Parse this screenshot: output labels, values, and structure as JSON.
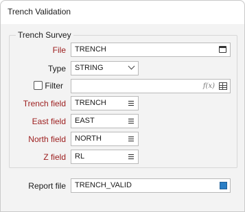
{
  "window": {
    "title": "Trench Validation"
  },
  "group": {
    "title": "Trench Survey"
  },
  "form": {
    "file": {
      "label": "File",
      "value": "TRENCH"
    },
    "type": {
      "label": "Type",
      "value": "STRING"
    },
    "filter": {
      "label": "Filter",
      "value": "",
      "checked": false
    },
    "trench_field": {
      "label": "Trench field",
      "value": "TRENCH"
    },
    "east_field": {
      "label": "East field",
      "value": "EAST"
    },
    "north_field": {
      "label": "North field",
      "value": "NORTH"
    },
    "z_field": {
      "label": "Z field",
      "value": "RL"
    }
  },
  "report": {
    "label": "Report file",
    "value": "TRENCH_VALID"
  },
  "icons": {
    "file_browse": "calendar-browse-icon",
    "type_dropdown": "chevron-down-icon",
    "filter_expression": "fx-icon",
    "filter_editor": "table-grid-icon",
    "field_list": "list-icon",
    "report_browse": "blue-square-icon"
  },
  "colors": {
    "required_label": "#9b1b1b",
    "accent": "#2a7ec5"
  }
}
